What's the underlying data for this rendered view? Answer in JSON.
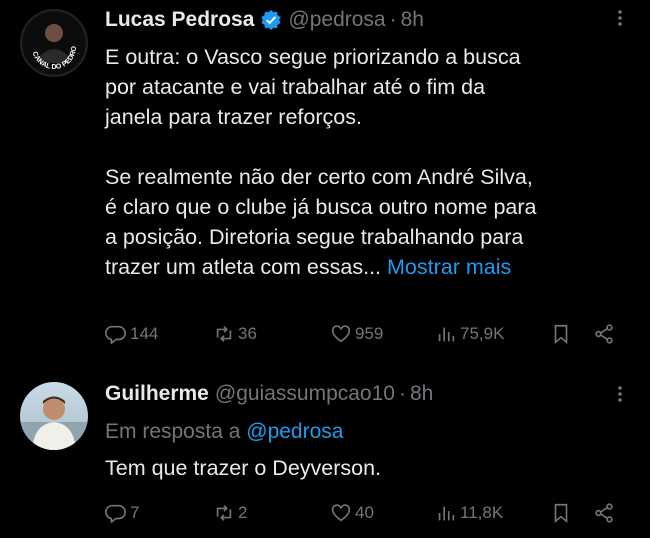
{
  "tweet1": {
    "name": "Lucas Pedrosa",
    "handle": "@pedrosa",
    "time": "8h",
    "avatar_text": "CANAL DO PEDROSA",
    "para1_lines": [
      "E outra: o Vasco segue priorizando a busca",
      "por atacante e vai trabalhar até o fim da",
      "janela para trazer reforços."
    ],
    "para2_lines": [
      "Se realmente não der certo com André Silva,",
      "é claro que o clube já busca outro nome para",
      "a posição. Diretoria segue trabalhando para"
    ],
    "para2_last": "trazer um atleta com essas...",
    "show_more": "Mostrar mais",
    "replies": "144",
    "reposts": "36",
    "likes": "959",
    "views": "75,9K"
  },
  "tweet2": {
    "name": "Guilherme",
    "handle": "@guiassumpcao10",
    "time": "8h",
    "replying_prefix": "Em resposta a",
    "replying_to": "@pedrosa",
    "text": "Tem que trazer o Deyverson.",
    "replies": "7",
    "reposts": "2",
    "likes": "40",
    "views": "11,8K"
  },
  "colors": {
    "accent": "#1d9bf0",
    "muted": "#71767b",
    "text": "#e7e9ea",
    "background": "#000000"
  },
  "icons": [
    "reply-icon",
    "repost-icon",
    "like-icon",
    "views-icon",
    "bookmark-icon",
    "share-icon",
    "verified-badge-icon",
    "more-icon"
  ]
}
